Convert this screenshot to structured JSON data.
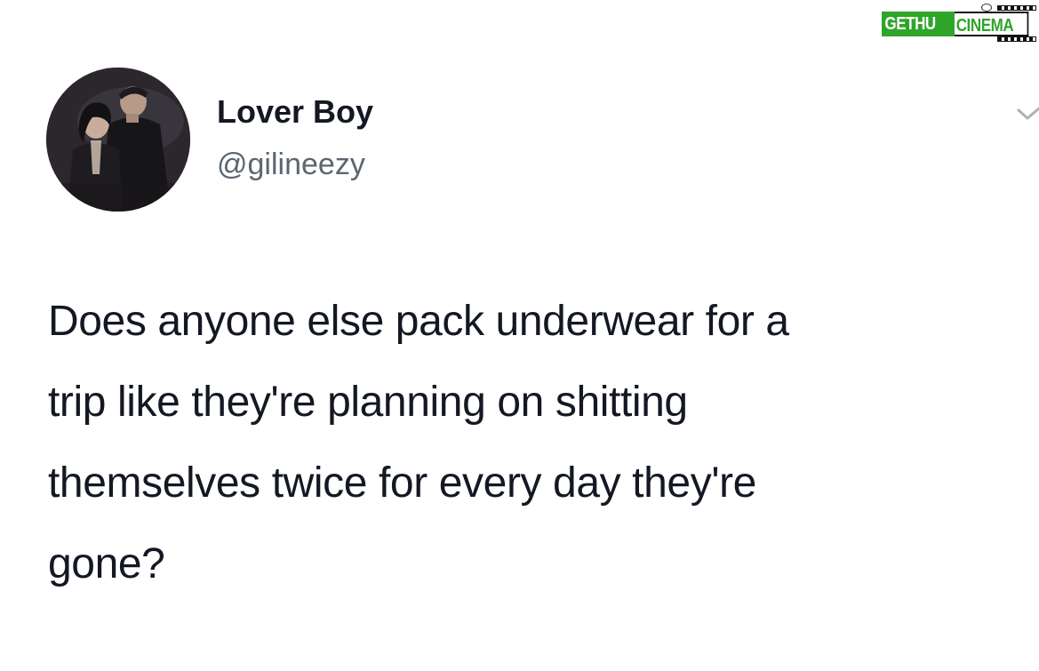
{
  "watermark": {
    "logo_left": "GETHU",
    "logo_right": "CINEMA",
    "brand_color": "#2ea52a"
  },
  "tweet": {
    "display_name": "Lover Boy",
    "handle": "@gilineezy",
    "avatar_icon": "profile-photo-icon",
    "menu_icon": "chevron-down-icon",
    "text_lines": [
      "Does anyone else pack underwear for a",
      "trip like they're planning on shitting",
      "themselves twice for every day they're",
      "gone?"
    ]
  }
}
